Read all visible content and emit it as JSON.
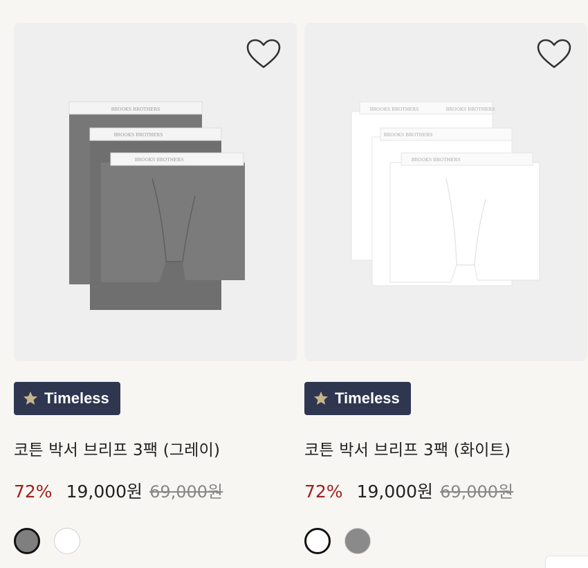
{
  "products": [
    {
      "badge": "Timeless",
      "title": "코튼 박서 브리프 3팩 (그레이)",
      "discount": "72%",
      "price": "19,000원",
      "original_price": "69,000원",
      "brand_band_text": "BROOKS BROTHERS",
      "product_color": "#7b7b7b",
      "swatches": [
        "grey",
        "white"
      ],
      "selected_swatch": "grey"
    },
    {
      "badge": "Timeless",
      "title": "코튼 박서 브리프 3팩 (화이트)",
      "discount": "72%",
      "price": "19,000원",
      "original_price": "69,000원",
      "brand_band_text": "BROOKS BROTHERS",
      "product_color": "#ffffff",
      "swatches": [
        "white",
        "grey"
      ],
      "selected_swatch": "white"
    }
  ],
  "icons": {
    "wishlist": "heart-outline-icon",
    "badge": "star-icon"
  },
  "colors": {
    "badge_bg": "#2e3650",
    "badge_star": "#c8b48c",
    "discount": "#a0201c"
  }
}
